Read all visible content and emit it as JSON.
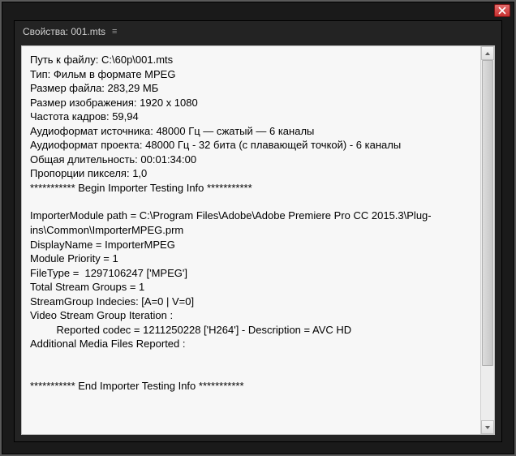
{
  "window": {
    "title": "Свойства: 001.mts"
  },
  "properties": {
    "path_label": "Путь к файлу:",
    "path_value": "C:\\60p\\001.mts",
    "type_label": "Тип:",
    "type_value": "Фильм в формате MPEG",
    "filesize_label": "Размер файла:",
    "filesize_value": "283,29 МБ",
    "imagesize_label": "Размер изображения:",
    "imagesize_value": "1920 x 1080",
    "framerate_label": "Частота кадров:",
    "framerate_value": "59,94",
    "src_audio_label": "Аудиоформат источника:",
    "src_audio_value": "48000 Гц — сжатый — 6 каналы",
    "proj_audio_label": "Аудиоформат проекта:",
    "proj_audio_value": "48000 Гц - 32 бита (с плавающей точкой) - 6 каналы",
    "duration_label": "Общая длительность:",
    "duration_value": "00:01:34:00",
    "par_label": "Пропорции пикселя:",
    "par_value": "1,0"
  },
  "importer": {
    "begin_marker": "*********** Begin Importer Testing Info ***********",
    "module_path_line": "ImporterModule path = C:\\Program Files\\Adobe\\Adobe Premiere Pro CC 2015.3\\Plug-ins\\Common\\ImporterMPEG.prm",
    "display_name_line": "DisplayName = ImporterMPEG",
    "module_priority_line": "Module Priority = 1",
    "filetype_line": "FileType =  1297106247 ['MPEG']",
    "total_groups_line": "Total Stream Groups = 1",
    "group_indices_line": "StreamGroup Indecies: [A=0 | V=0]",
    "video_iter_line": "Video Stream Group Iteration :",
    "reported_codec_line": "         Reported codec = 1211250228 ['H264'] - Description = AVC HD",
    "additional_media_line": "Additional Media Files Reported :",
    "end_marker": "*********** End Importer Testing Info ***********"
  }
}
